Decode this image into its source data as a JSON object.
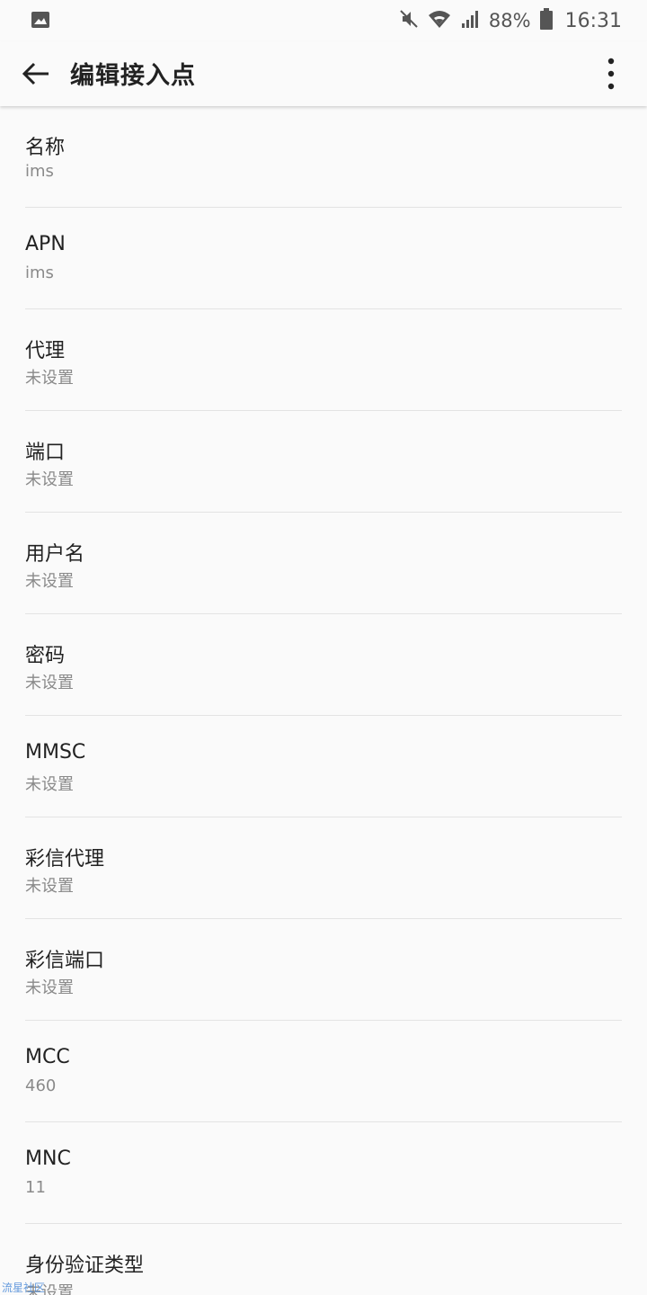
{
  "status_bar": {
    "icons": [
      "image-notification-icon",
      "mute-icon",
      "wifi-icon",
      "signal-icon",
      "battery-icon"
    ],
    "battery_percent": "88%",
    "time": "16:31"
  },
  "app_bar": {
    "title": "编辑接入点"
  },
  "fields": [
    {
      "label": "名称",
      "value": "ims"
    },
    {
      "label": "APN",
      "value": "ims"
    },
    {
      "label": "代理",
      "value": "未设置"
    },
    {
      "label": "端口",
      "value": "未设置"
    },
    {
      "label": "用户名",
      "value": "未设置"
    },
    {
      "label": "密码",
      "value": "未设置"
    },
    {
      "label": "MMSC",
      "value": "未设置"
    },
    {
      "label": "彩信代理",
      "value": "未设置"
    },
    {
      "label": "彩信端口",
      "value": "未设置"
    },
    {
      "label": "MCC",
      "value": "460"
    },
    {
      "label": "MNC",
      "value": "11"
    },
    {
      "label": "身份验证类型",
      "value": "未设置"
    }
  ],
  "watermark": "流星社区"
}
